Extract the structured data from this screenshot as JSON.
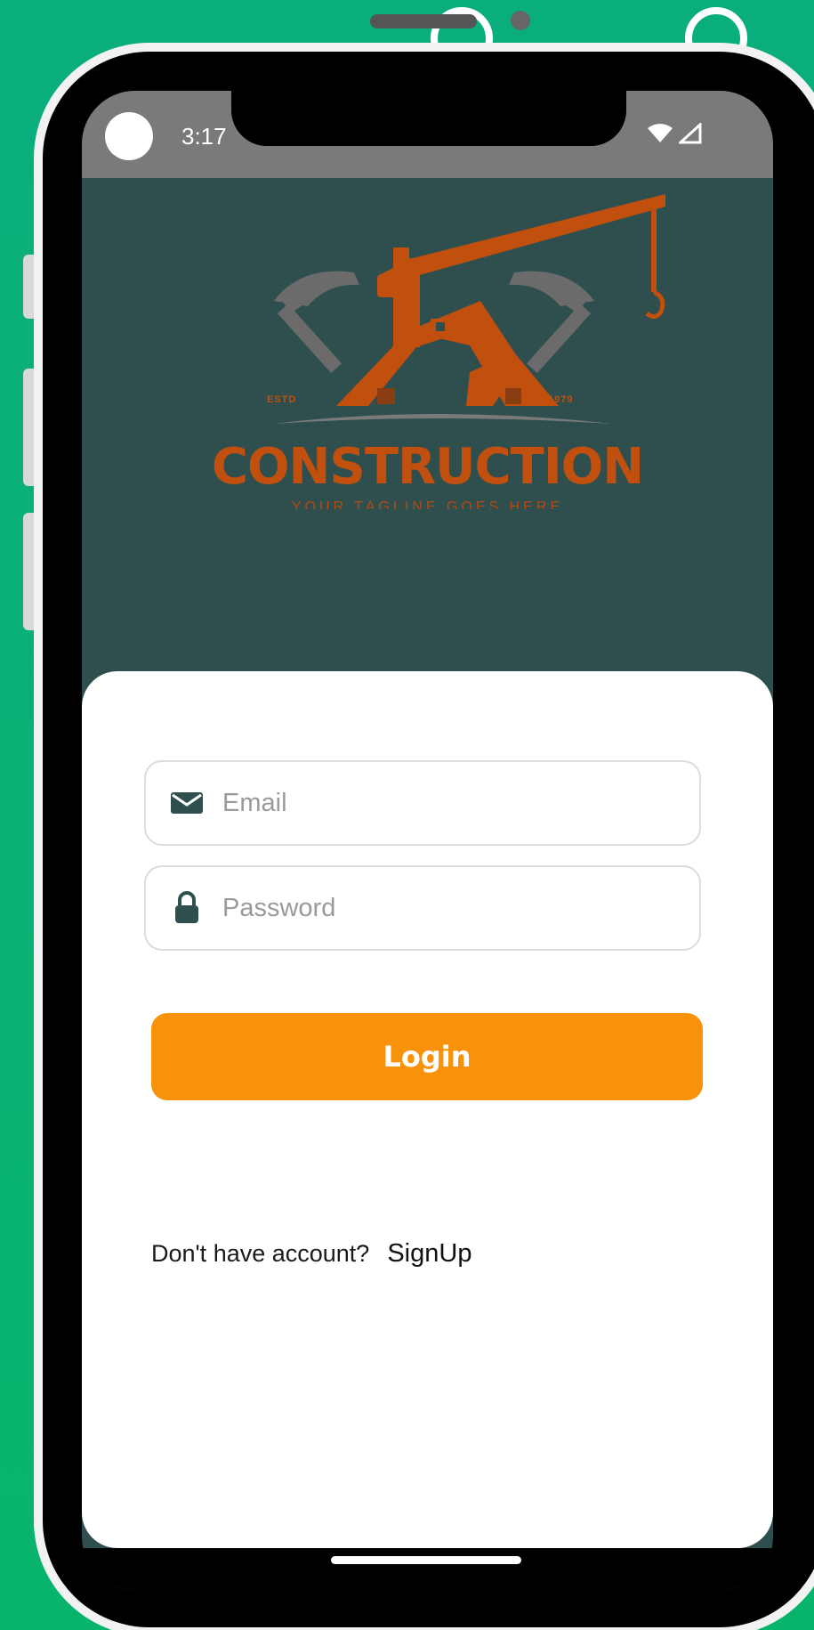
{
  "status_bar": {
    "time": "3:17",
    "wifi_icon": "wifi-icon",
    "signal_icon": "signal-icon"
  },
  "logo": {
    "wordmark": "CONSTRUCTION",
    "tagline": "YOUR TAGLINE GOES HERE",
    "estd": "ESTD",
    "year": "1979"
  },
  "login_form": {
    "email_placeholder": "Email",
    "email_value": "",
    "email_icon": "envelope-icon",
    "password_placeholder": "Password",
    "password_value": "",
    "password_icon": "lock-icon",
    "login_label": "Login"
  },
  "signup": {
    "prompt": "Don't have account?",
    "link": "SignUp"
  },
  "colors": {
    "page_background": "#0aae7d",
    "header_background": "#2f4f4f",
    "logo_orange": "#c14f0e",
    "button_orange": "#f7920a",
    "status_bar": "#7a7a7a"
  }
}
